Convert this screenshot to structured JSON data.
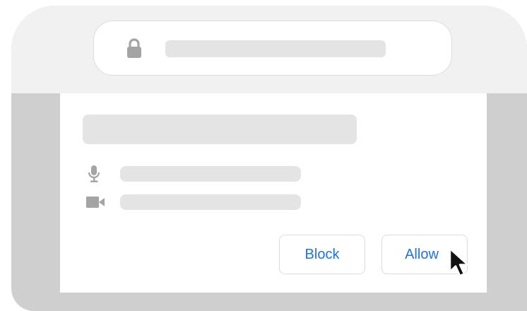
{
  "address_bar": {
    "lock_icon": "lock-icon"
  },
  "permission_prompt": {
    "permissions": [
      {
        "icon": "microphone-icon"
      },
      {
        "icon": "camera-icon"
      }
    ],
    "buttons": {
      "block_label": "Block",
      "allow_label": "Allow"
    }
  },
  "colors": {
    "frame": "#cfcfcf",
    "toolbar": "#f1f1f1",
    "placeholder": "#e4e4e4",
    "icon_gray": "#a4a4a4",
    "button_text": "#1a73e8",
    "button_border": "#dadce0"
  },
  "cursor": {
    "icon": "mouse-pointer-icon"
  }
}
